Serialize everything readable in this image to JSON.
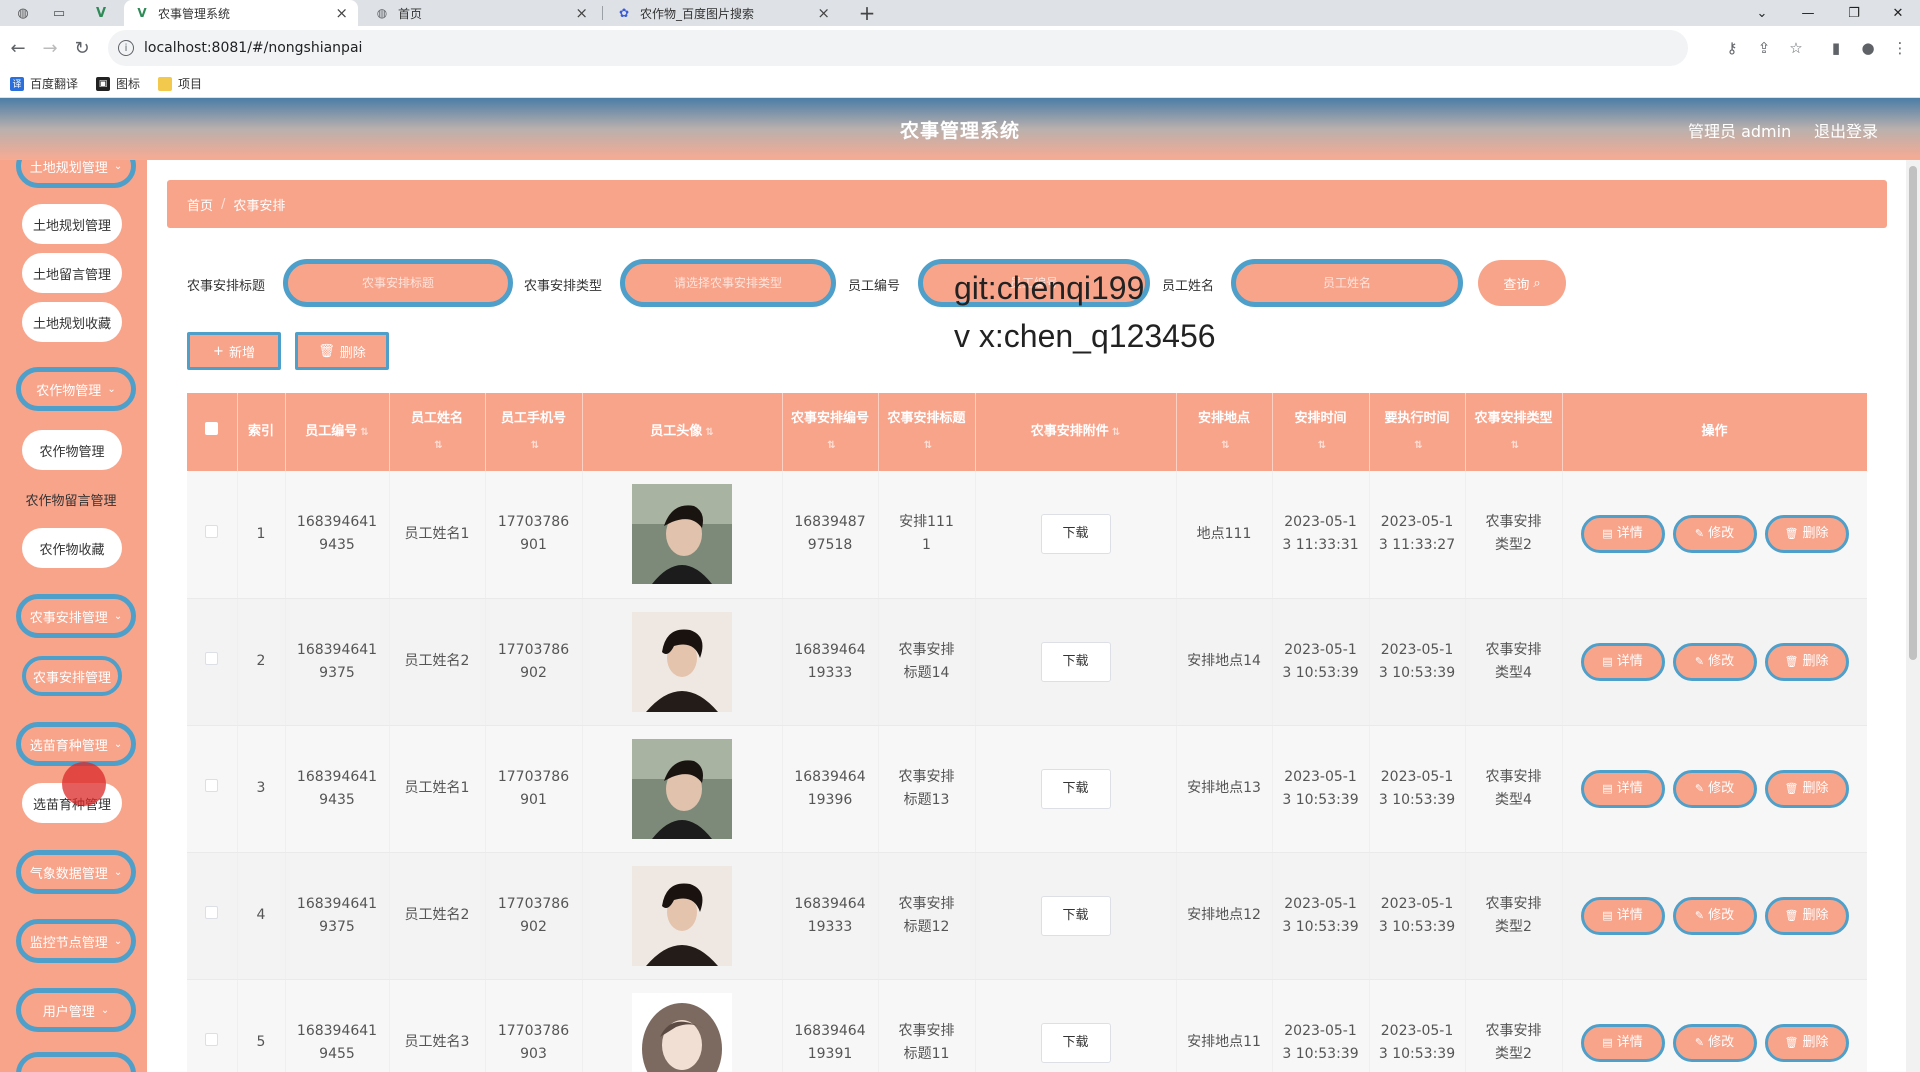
{
  "browser": {
    "tabs": [
      {
        "title": "农事管理系统",
        "active": true
      },
      {
        "title": "首页",
        "active": false
      },
      {
        "title": "农作物_百度图片搜索",
        "active": false
      }
    ],
    "url": "localhost:8081/#/nongshianpai",
    "bookmarks": [
      "百度翻译",
      "图标",
      "项目"
    ]
  },
  "header": {
    "title": "农事管理系统",
    "user": "管理员 admin",
    "logout": "退出登录"
  },
  "sidebar": {
    "items": [
      {
        "label": "土地规划管理",
        "type": "main"
      },
      {
        "label": "土地规划管理",
        "type": "sub"
      },
      {
        "label": "土地留言管理",
        "type": "sub"
      },
      {
        "label": "土地规划收藏",
        "type": "sub"
      },
      {
        "label": "农作物管理",
        "type": "main"
      },
      {
        "label": "农作物管理",
        "type": "sub"
      },
      {
        "label": "农作物留言管理",
        "type": "sub"
      },
      {
        "label": "农作物收藏",
        "type": "sub"
      },
      {
        "label": "农事安排管理",
        "type": "main"
      },
      {
        "label": "农事安排管理",
        "type": "sub-active"
      },
      {
        "label": "选苗育种管理",
        "type": "main"
      },
      {
        "label": "选苗育种管理",
        "type": "sub"
      },
      {
        "label": "气象数据管理",
        "type": "main"
      },
      {
        "label": "监控节点管理",
        "type": "main"
      },
      {
        "label": "用户管理",
        "type": "main"
      }
    ]
  },
  "breadcrumb": {
    "home": "首页",
    "current": "农事安排"
  },
  "search": {
    "fields": [
      {
        "label": "农事安排标题",
        "placeholder": "农事安排标题"
      },
      {
        "label": "农事安排类型",
        "placeholder": "请选择农事安排类型"
      },
      {
        "label": "员工编号",
        "placeholder": "员工编号"
      },
      {
        "label": "员工姓名",
        "placeholder": "员工姓名"
      }
    ],
    "query_label": "查询"
  },
  "actions": {
    "add": "新增",
    "delete": "删除"
  },
  "watermark": [
    "git:chenqi199",
    "v x:chen_q123456"
  ],
  "table": {
    "headers": [
      "索引",
      "员工编号",
      "员工姓名",
      "员工手机号",
      "员工头像",
      "农事安排编号",
      "农事安排标题",
      "农事安排附件",
      "安排地点",
      "安排时间",
      "要执行时间",
      "农事安排类型",
      "操作"
    ],
    "download_label": "下载",
    "row_actions": [
      "详情",
      "修改",
      "删除"
    ],
    "rows": [
      {
        "index": "1",
        "emp_no": "1683946419435",
        "emp_name": "员工姓名1",
        "phone": "17703786901",
        "avatar": "man-a",
        "plan_no": "1683948797518",
        "title": "安排1111",
        "location": "地点111",
        "time": "2023-05-13 11:33:31",
        "exec_time": "2023-05-13 11:33:27",
        "type": "农事安排类型2"
      },
      {
        "index": "2",
        "emp_no": "1683946419375",
        "emp_name": "员工姓名2",
        "phone": "17703786902",
        "avatar": "man-b",
        "plan_no": "1683946419333",
        "title": "农事安排标题14",
        "location": "安排地点14",
        "time": "2023-05-13 10:53:39",
        "exec_time": "2023-05-13 10:53:39",
        "type": "农事安排类型4"
      },
      {
        "index": "3",
        "emp_no": "1683946419435",
        "emp_name": "员工姓名1",
        "phone": "17703786901",
        "avatar": "man-a",
        "plan_no": "1683946419396",
        "title": "农事安排标题13",
        "location": "安排地点13",
        "time": "2023-05-13 10:53:39",
        "exec_time": "2023-05-13 10:53:39",
        "type": "农事安排类型4"
      },
      {
        "index": "4",
        "emp_no": "1683946419375",
        "emp_name": "员工姓名2",
        "phone": "17703786902",
        "avatar": "man-b",
        "plan_no": "1683946419333",
        "title": "农事安排标题12",
        "location": "安排地点12",
        "time": "2023-05-13 10:53:39",
        "exec_time": "2023-05-13 10:53:39",
        "type": "农事安排类型2"
      },
      {
        "index": "5",
        "emp_no": "1683946419455",
        "emp_name": "员工姓名3",
        "phone": "17703786903",
        "avatar": "woman",
        "plan_no": "1683946419391",
        "title": "农事安排标题11",
        "location": "安排地点11",
        "time": "2023-05-13 10:53:39",
        "exec_time": "2023-05-13 10:53:39",
        "type": "农事安排类型2"
      }
    ]
  },
  "colors": {
    "accent": "#f8a48b",
    "border_blue": "#4e9fc9"
  }
}
